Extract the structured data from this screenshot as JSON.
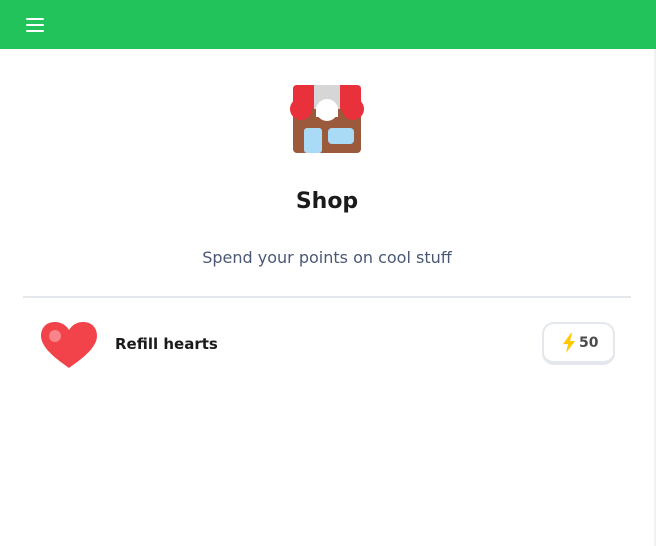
{
  "header": {
    "menu_icon": "hamburger-menu-icon",
    "background_color": "#22c35a"
  },
  "shop": {
    "icon": "storefront-icon",
    "title": "Shop",
    "subtitle": "Spend your points on cool stuff"
  },
  "items": [
    {
      "icon": "heart-icon",
      "label": "Refill hearts",
      "price": "50",
      "currency_icon": "lightning-bolt-icon"
    }
  ],
  "colors": {
    "accent_green": "#22c35a",
    "heart_red": "#f2434a",
    "bolt_yellow": "#ffc800",
    "subtitle_gray": "#4a5874"
  }
}
